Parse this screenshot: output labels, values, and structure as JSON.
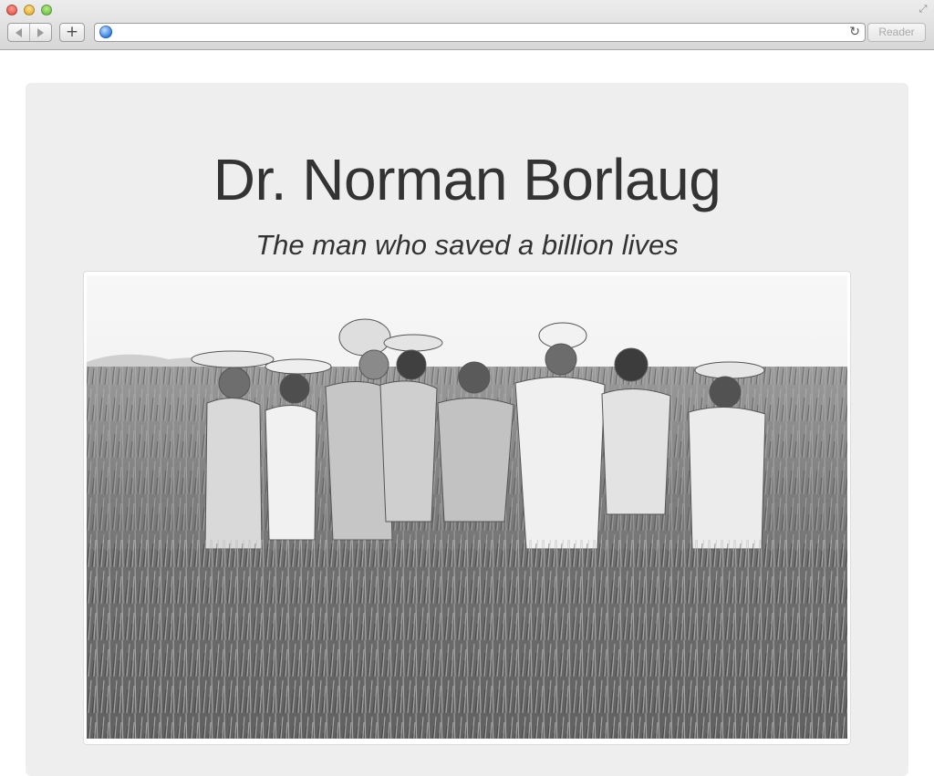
{
  "browser": {
    "url": "",
    "reader_label": "Reader",
    "reload_glyph": "↻",
    "add_glyph": "+",
    "fullscreen_glyph": "⤢",
    "icons": [
      "close-light",
      "minimize-light",
      "zoom-light",
      "back-arrow-icon",
      "forward-arrow-icon",
      "new-tab-icon",
      "globe-icon",
      "reload-icon",
      "fullscreen-icon"
    ]
  },
  "page": {
    "title": "Dr. Norman Borlaug",
    "subtitle": "The man who saved a billion lives",
    "colors": {
      "jumbotron_bg": "#eeeeee",
      "text": "#333333",
      "thumbnail_border": "#dddddd"
    }
  }
}
